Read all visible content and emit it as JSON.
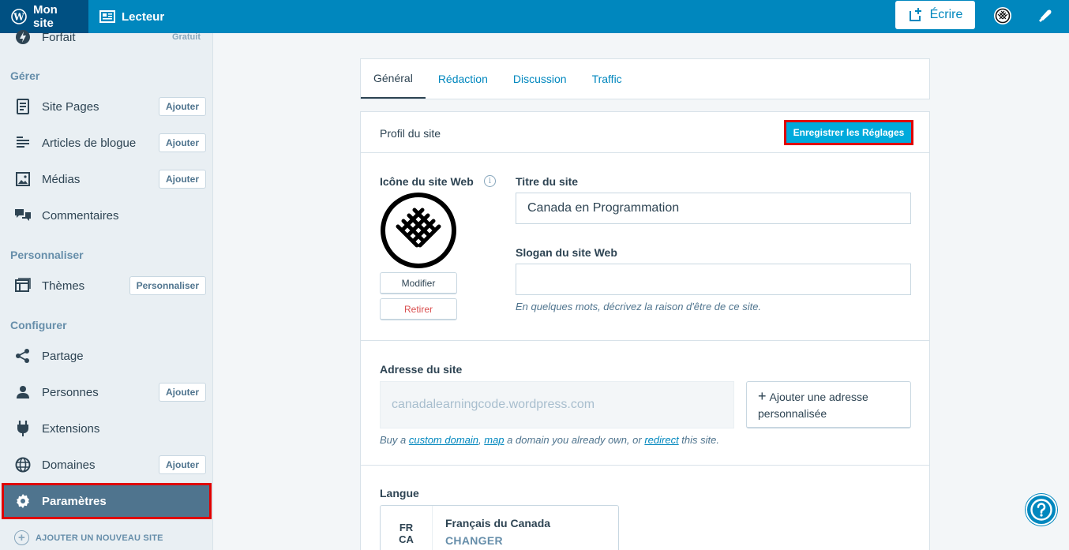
{
  "topbar": {
    "my_site": "Mon site",
    "reader": "Lecteur",
    "write": "Écrire"
  },
  "sidebar": {
    "plan": {
      "label": "Forfait",
      "badge": "Gratuit"
    },
    "manage_heading": "Gérer",
    "manage_items": [
      {
        "label": "Site Pages",
        "action": "Ajouter"
      },
      {
        "label": "Articles de blogue",
        "action": "Ajouter"
      },
      {
        "label": "Médias",
        "action": "Ajouter"
      },
      {
        "label": "Commentaires"
      }
    ],
    "personalize_heading": "Personnaliser",
    "themes": {
      "label": "Thèmes",
      "action": "Personnaliser"
    },
    "configure_heading": "Configurer",
    "configure_items": [
      {
        "label": "Partage"
      },
      {
        "label": "Personnes",
        "action": "Ajouter"
      },
      {
        "label": "Extensions"
      },
      {
        "label": "Domaines",
        "action": "Ajouter"
      },
      {
        "label": "Paramètres"
      }
    ],
    "add_site": "AJOUTER UN NOUVEAU SITE"
  },
  "tabs": [
    "Général",
    "Rédaction",
    "Discussion",
    "Traffic"
  ],
  "profile": {
    "title": "Profil du site",
    "save": "Enregistrer les Réglages",
    "site_icon_label": "Icône du site Web",
    "modify": "Modifier",
    "remove": "Retirer",
    "site_title_label": "Titre du site",
    "site_title_value": "Canada en Programmation",
    "tagline_label": "Slogan du site Web",
    "tagline_value": "",
    "tagline_hint": "En quelques mots, décrivez la raison d'être de ce site."
  },
  "address": {
    "label": "Adresse du site",
    "value": "canadalearningcode.wordpress.com",
    "add_button": "Ajouter une adresse personnalisée",
    "hint_pre": "Buy a ",
    "hint_link1": "custom domain",
    "hint_sep": ", ",
    "hint_link2": "map",
    "hint_mid": " a domain you already own, or ",
    "hint_link3": "redirect",
    "hint_post": " this site."
  },
  "language": {
    "label": "Langue",
    "code_line1": "FR",
    "code_line2": "CA",
    "name": "Français du Canada",
    "change": "CHANGER"
  },
  "colors": {
    "topbar": "#0087be",
    "accent": "#00aadc",
    "highlight": "#e00000",
    "selected": "#4f748e"
  }
}
